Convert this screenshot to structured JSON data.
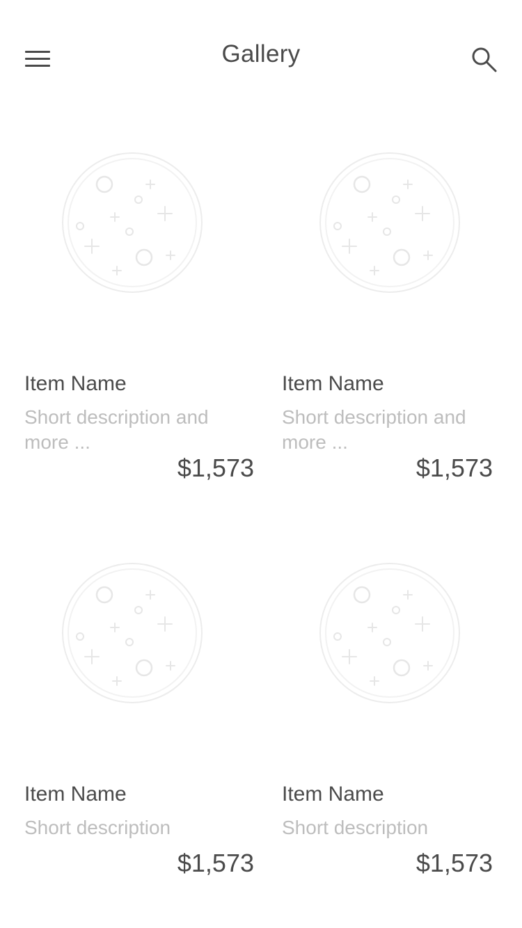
{
  "header": {
    "title": "Gallery",
    "menu_icon": "hamburger-menu-icon",
    "search_icon": "search-icon"
  },
  "items": [
    {
      "name": "Item Name",
      "description": "Short description and more ...",
      "price": "$1,573",
      "image_icon": "placeholder-image-icon"
    },
    {
      "name": "Item Name",
      "description": "Short description and more ...",
      "price": "$1,573",
      "image_icon": "placeholder-image-icon"
    },
    {
      "name": "Item Name",
      "description": "Short description",
      "price": "$1,573",
      "image_icon": "placeholder-image-icon"
    },
    {
      "name": "Item Name",
      "description": "Short description",
      "price": "$1,573",
      "image_icon": "placeholder-image-icon"
    }
  ],
  "colors": {
    "text_primary": "#4a4a4a",
    "text_secondary": "#bdbdbd",
    "placeholder_stroke": "#e6e6e6",
    "background": "#ffffff"
  }
}
